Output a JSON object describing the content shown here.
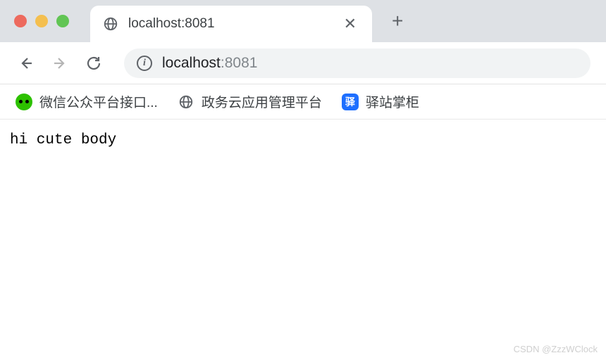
{
  "window": {
    "tab_title": "localhost:8081"
  },
  "address": {
    "host": "localhost",
    "port": ":8081"
  },
  "bookmarks": {
    "b1": "微信公众平台接口...",
    "b2": "政务云应用管理平台",
    "b3_icon": "驿",
    "b3": "驿站掌柜"
  },
  "page": {
    "body_text": "hi cute body"
  },
  "watermark": "CSDN @ZzzWClock"
}
